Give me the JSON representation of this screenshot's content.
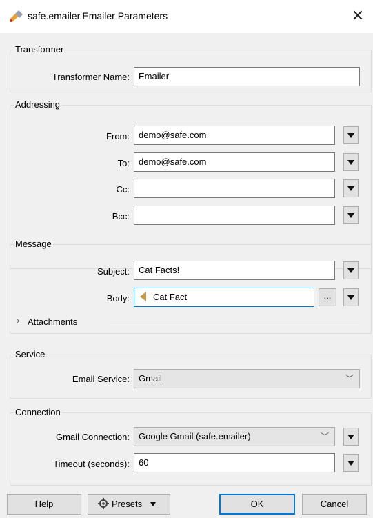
{
  "window": {
    "title": "safe.emailer.Emailer Parameters",
    "close_glyph": "✕"
  },
  "transformer": {
    "legend": "Transformer",
    "name_label": "Transformer Name:",
    "name_value": "Emailer"
  },
  "addressing": {
    "legend": "Addressing",
    "from_label": "From:",
    "from_value": "demo@safe.com",
    "to_label": "To:",
    "to_value": "demo@safe.com",
    "cc_label": "Cc:",
    "cc_value": "",
    "bcc_label": "Bcc:",
    "bcc_value": ""
  },
  "message": {
    "legend": "Message",
    "subject_label": "Subject:",
    "subject_value": "Cat Facts!",
    "body_label": "Body:",
    "body_value": "Cat Fact",
    "body_ellipsis": "...",
    "attachments_label": "Attachments"
  },
  "service": {
    "legend": "Service",
    "email_service_label": "Email Service:",
    "email_service_value": "Gmail"
  },
  "connection": {
    "legend": "Connection",
    "gmail_connection_label": "Gmail Connection:",
    "gmail_connection_value": "Google Gmail (safe.emailer)",
    "timeout_label": "Timeout (seconds):",
    "timeout_value": "60"
  },
  "buttons": {
    "help": "Help",
    "presets": "Presets",
    "ok": "OK",
    "cancel": "Cancel"
  },
  "icons": {
    "title": "fme-transformer-icon",
    "feature": "feature-attribute-icon",
    "presets": "presets-gear-icon",
    "dropdown": "dropdown-arrow-icon",
    "chevron": "chevron-down-icon",
    "expand": "chevron-right-icon"
  },
  "colors": {
    "focus": "#0078d7",
    "dialog_bg": "#f0f0f0",
    "feature_icon": "#c79a48"
  }
}
